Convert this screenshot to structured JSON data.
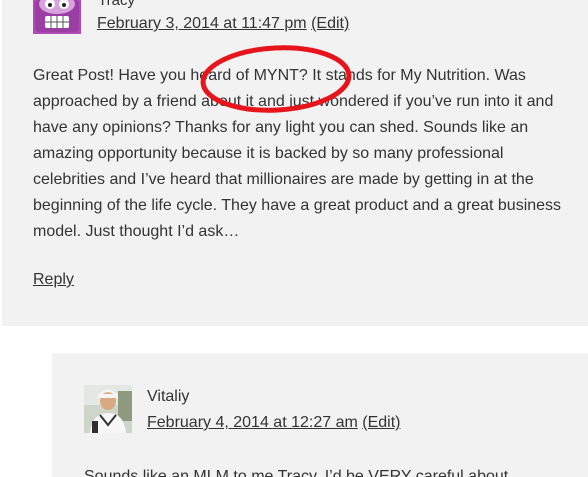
{
  "comments": [
    {
      "author": "Tracy",
      "avatar_icon": "monster-avatar-icon",
      "date": "February 3, 2014 at 11:47 pm",
      "edit": "(Edit)",
      "body": "Great Post! Have you heard of MYNT? It stands for My Nutrition. Was approached by a friend about it and just wondered if you’ve run into it and have any opinions? Thanks for any light you can shed. Sounds like an amazing opportunity because it is backed by so many professional celebrities and I’ve heard that millionaires are made by getting in at the beginning of the life cycle. They have a great product and a great business model. Just thought I’d ask…",
      "reply": "Reply"
    },
    {
      "author": "Vitaliy",
      "avatar_icon": "person-photo-avatar-icon",
      "date": "February 4, 2014 at 12:27 am",
      "edit": "(Edit)",
      "body": "Sounds like an MLM to me Tracy. I’d be VERY careful about"
    }
  ],
  "colors": {
    "comment_background": "#f2f2f2",
    "text": "#333333",
    "highlight_circle": "#e8141b"
  }
}
